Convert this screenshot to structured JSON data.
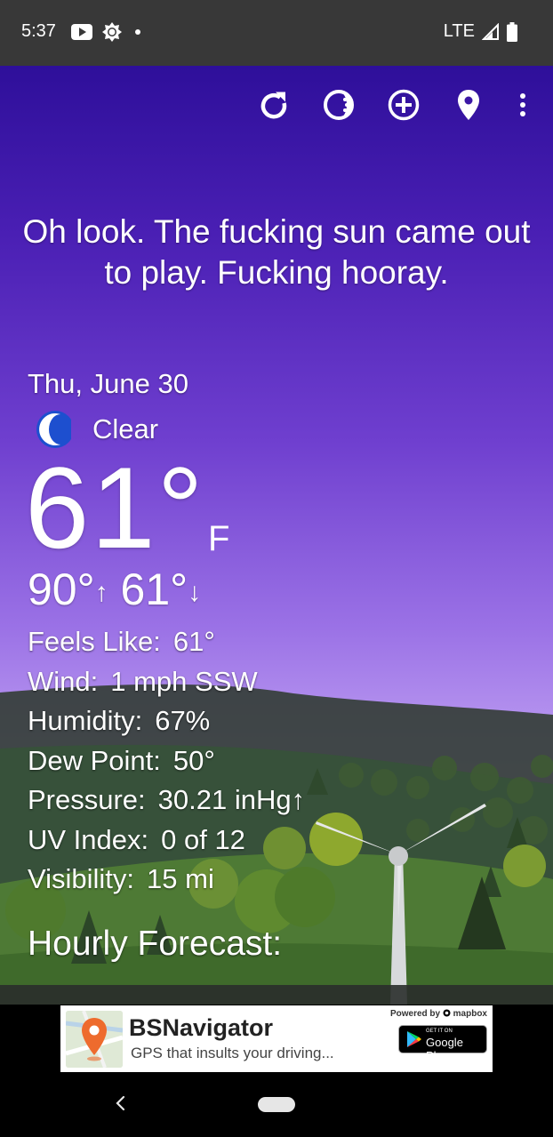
{
  "status_bar": {
    "time": "5:37",
    "network": "LTE",
    "icons": [
      "youtube-icon",
      "brightness-icon",
      "dot-icon",
      "signal-icon",
      "battery-icon"
    ]
  },
  "toolbar": {
    "icons": [
      "refresh-icon",
      "theme-icon",
      "add-location-icon",
      "location-pin-icon",
      "more-vert-icon"
    ]
  },
  "weather": {
    "quote": "Oh look. The fucking sun came out to play. Fucking hooray.",
    "date": "Thu, June 30",
    "condition": "Clear",
    "condition_icon": "moon-icon",
    "temp": "61°",
    "unit": "F",
    "high": "90°",
    "high_arrow": "↑",
    "low": "61°",
    "low_arrow": "↓",
    "details": [
      {
        "label": "Feels Like:",
        "value": "61°"
      },
      {
        "label": "Wind:",
        "value": "1 mph SSW"
      },
      {
        "label": "Humidity:",
        "value": "67%"
      },
      {
        "label": "Dew Point:",
        "value": "50°"
      },
      {
        "label": "Pressure:",
        "value": "30.21 inHg↑"
      },
      {
        "label": "UV Index:",
        "value": "0 of 12"
      },
      {
        "label": "Visibility:",
        "value": "15 mi"
      }
    ],
    "hourly_heading": "Hourly Forecast:"
  },
  "ad": {
    "name": "BSNavigator",
    "tagline": "GPS that insults your driving...",
    "powered_by": "Powered by",
    "powered_brand": "mapbox",
    "store_small": "GET IT ON",
    "store_name": "Google Play"
  },
  "colors": {
    "sky_top": "#2e0f9a",
    "sky_bottom": "#c9aef2",
    "hill_dark": "#2f3a30",
    "hill_green": "#4e7a35",
    "status_bar": "#383838",
    "nav_bar": "#000000"
  }
}
